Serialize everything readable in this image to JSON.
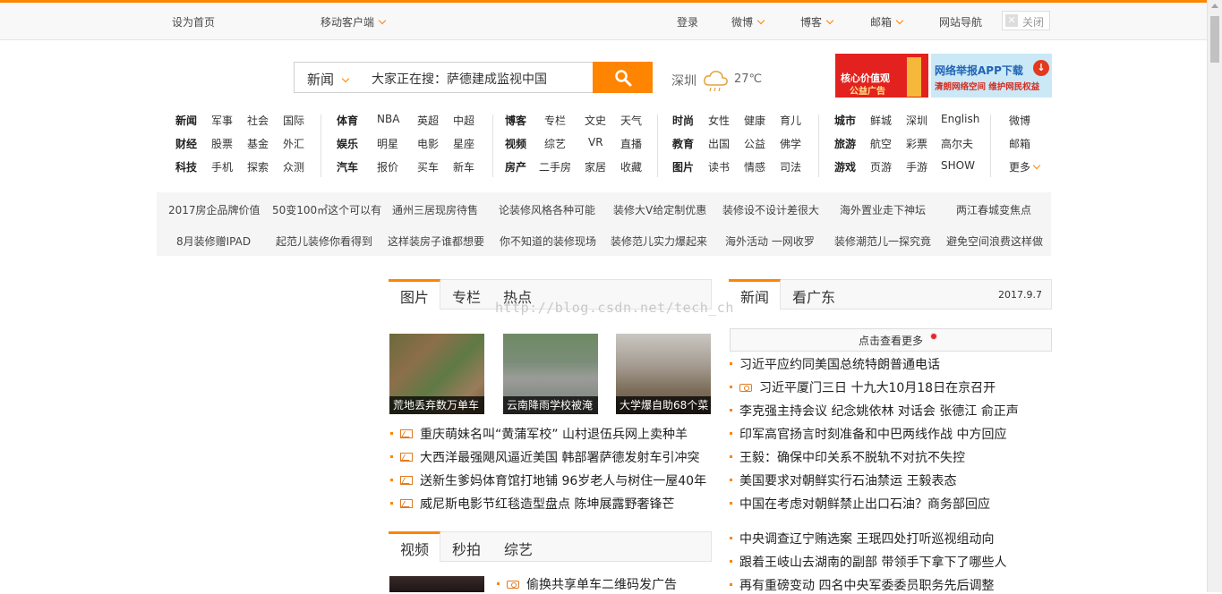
{
  "topbar": {
    "set_home": "设为首页",
    "mobile_client": "移动客户端",
    "login": "登录",
    "weibo": "微博",
    "blog": "博客",
    "mail": "邮箱",
    "site_nav": "网站导航",
    "close": "关闭"
  },
  "search": {
    "category": "新闻",
    "placeholder": "大家正在搜：萨德建成监视中国"
  },
  "weather": {
    "city": "深圳",
    "temp": "27℃"
  },
  "banners": {
    "b1_line1": "核心价值观",
    "b1_line2": "公益广告",
    "b2_line1": "网络举报APP下载",
    "b2_line2": "清朗网络空间 维护网民权益"
  },
  "nav": {
    "col1": [
      [
        "新闻",
        "军事",
        "社会",
        "国际"
      ],
      [
        "财经",
        "股票",
        "基金",
        "外汇"
      ],
      [
        "科技",
        "手机",
        "探索",
        "众测"
      ]
    ],
    "col2": [
      [
        "体育",
        "NBA",
        "英超",
        "中超"
      ],
      [
        "娱乐",
        "明星",
        "电影",
        "星座"
      ],
      [
        "汽车",
        "报价",
        "买车",
        "新车"
      ]
    ],
    "col3": [
      [
        "博客",
        "专栏",
        "文史",
        "天气"
      ],
      [
        "视频",
        "综艺",
        "VR",
        "直播"
      ],
      [
        "房产",
        "二手房",
        "家居",
        "收藏"
      ]
    ],
    "col4": [
      [
        "时尚",
        "女性",
        "健康",
        "育儿"
      ],
      [
        "教育",
        "出国",
        "公益",
        "佛学"
      ],
      [
        "图片",
        "读书",
        "情感",
        "司法"
      ]
    ],
    "col5": [
      [
        "城市",
        "鲜城",
        "深圳",
        "English"
      ],
      [
        "旅游",
        "航空",
        "彩票",
        "高尔夫"
      ],
      [
        "游戏",
        "页游",
        "手游",
        "SHOW"
      ]
    ],
    "col6": [
      "微博",
      "邮箱",
      "更多"
    ]
  },
  "hot": {
    "row1": [
      "2017房企品牌价值",
      "50变100㎡这个可以有",
      "通州三居现房待售",
      "论装修风格各种可能",
      "装修大V给定制优惠",
      "装修设不设计差很大",
      "海外置业走下神坛",
      "两江春城变焦点"
    ],
    "row2": [
      "8月装修赠IPAD",
      "起范儿装修你看得到",
      "这样装房子谁都想要",
      "你不知道的装修现场",
      "装修范儿实力爆起来",
      "海外活动 一网收罗",
      "装修潮范儿一探究竟",
      "避免空间浪费这样做"
    ]
  },
  "tabs_pic": [
    "图片",
    "专栏",
    "热点"
  ],
  "tabs_news": [
    "新闻",
    "看广东"
  ],
  "news_date": "2017.9.7",
  "tabs_video": [
    "视频",
    "秒拍",
    "综艺"
  ],
  "pics": [
    {
      "caption": "荒地丢弃数万单车"
    },
    {
      "caption": "云南降雨学校被淹"
    },
    {
      "caption": "大学爆自助68个菜"
    }
  ],
  "left_news": [
    "重庆萌妹名叫“黄蒲军校”  山村退伍兵网上卖种羊",
    "大西洋最强飓风逼近美国  韩部署萨德发射车引冲突",
    "送新生爹妈体育馆打地铺  96岁老人与树住一屋40年",
    "威尼斯电影节红毯造型盘点  陈坤展露野奢锋芒"
  ],
  "left_video_news": [
    "偷换共享单车二维码发广告"
  ],
  "more_link": "点击查看更多",
  "right_news": [
    "习近平应约同美国总统特朗普通电话",
    "习近平厦门三日  十九大10月18日在京召开",
    "李克强主持会议  纪念姚依林  对话会  张德江  俞正声",
    "印军高官扬言时刻准备和中巴两线作战  中方回应",
    "王毅：确保中印关系不脱轨不对抗不失控",
    "美国要求对朝鲜实行石油禁运  王毅表态",
    "中国在考虑对朝鲜禁止出口石油？商务部回应"
  ],
  "right_news2": [
    "中央调查辽宁贿选案  王珉四处打听巡视组动向",
    "跟着王岐山去湖南的副部  带领手下拿下了哪些人",
    "再有重磅变动  四名中央军委委员职务先后调整"
  ],
  "watermark": "http://blog.csdn.net/tech_ch"
}
